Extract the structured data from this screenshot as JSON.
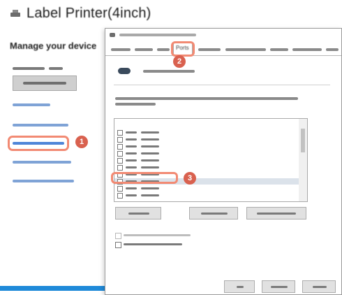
{
  "background_page": {
    "title": "Label Printer(4inch)",
    "manage_heading": "Manage your device",
    "printer_icon": "printer-icon"
  },
  "dialog": {
    "tabs_visible_label": "Ports",
    "printer_icon": "printer-icon",
    "selected_port_index": 8
  },
  "annotations": {
    "badges": [
      "1",
      "2",
      "3"
    ],
    "highlight_color": "#f28a73",
    "badge_color": "#d9614f"
  },
  "colors": {
    "link": "#7fa3d6",
    "accent_bar": "#1f8ad9"
  }
}
